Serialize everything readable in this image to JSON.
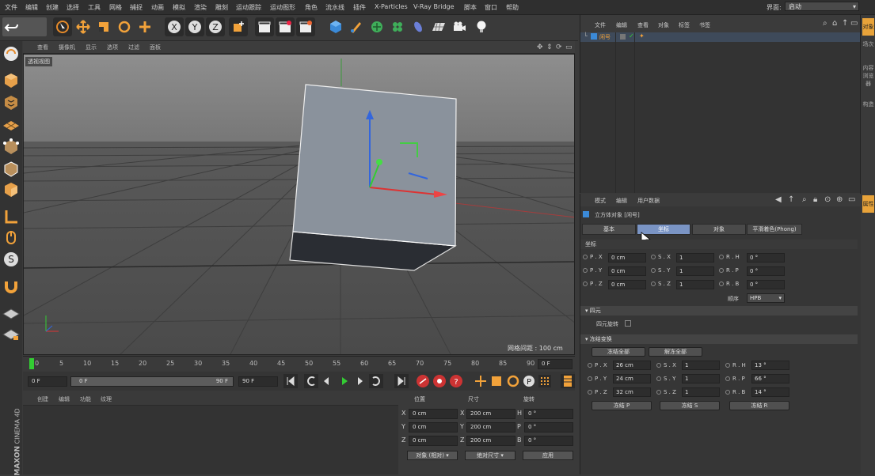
{
  "menu": [
    "文件",
    "编辑",
    "创建",
    "选择",
    "工具",
    "网格",
    "捕捉",
    "动画",
    "模拟",
    "渲染",
    "雕刻",
    "运动跟踪",
    "运动图形",
    "角色",
    "流水线",
    "插件",
    "X-Particles",
    "V-Ray Bridge",
    "脚本",
    "窗口",
    "帮助"
  ],
  "interface": {
    "label": "界面:",
    "value": "启动"
  },
  "viewport": {
    "menu": [
      "查看",
      "摄像机",
      "显示",
      "选项",
      "过滤",
      "面板"
    ],
    "label": "透视视图",
    "grid_spacing": "网格间距 : 100 cm"
  },
  "timeline": {
    "ticks": [
      "0",
      "5",
      "10",
      "15",
      "20",
      "25",
      "30",
      "35",
      "40",
      "45",
      "50",
      "55",
      "60",
      "65",
      "70",
      "75",
      "80",
      "85",
      "90"
    ],
    "current_frame": "0 F"
  },
  "transport": {
    "start": "0 F",
    "slider_start": "0 F",
    "slider_end": "90 F",
    "end": "90 F"
  },
  "material_panel": {
    "menu": [
      "创建",
      "编辑",
      "功能",
      "纹理"
    ]
  },
  "coordinates": {
    "headers": [
      "位置",
      "尺寸",
      "旋转"
    ],
    "rows": [
      {
        "axis": "X",
        "pos": "0 cm",
        "size_axis": "X",
        "size": "200 cm",
        "rot_axis": "H",
        "rot": "0 °"
      },
      {
        "axis": "Y",
        "pos": "0 cm",
        "size_axis": "Y",
        "size": "200 cm",
        "rot_axis": "P",
        "rot": "0 °"
      },
      {
        "axis": "Z",
        "pos": "0 cm",
        "size_axis": "Z",
        "size": "200 cm",
        "rot_axis": "B",
        "rot": "0 °"
      }
    ],
    "mode": "对象 (相对)",
    "size_mode": "绝对尺寸",
    "apply": "应用"
  },
  "object_manager": {
    "menu": [
      "文件",
      "编辑",
      "查看",
      "对象",
      "标签",
      "书签"
    ],
    "object_name": "闲号"
  },
  "right_strip": [
    "对象",
    "场次",
    "内容浏览器",
    "构造",
    "属性"
  ],
  "attributes": {
    "menu": [
      "模式",
      "编辑",
      "用户数据"
    ],
    "title": "立方体对象 [闲号]",
    "tabs": [
      "基本",
      "坐标",
      "对象",
      "平滑着色(Phong)"
    ],
    "active_tab": 1,
    "section_coord": "坐标",
    "coord_rows": [
      {
        "p": "P . X",
        "pv": "0 cm",
        "s": "S . X",
        "sv": "1",
        "r": "R . H",
        "rv": "0 °"
      },
      {
        "p": "P . Y",
        "pv": "0 cm",
        "s": "S . Y",
        "sv": "1",
        "r": "R . P",
        "rv": "0 °"
      },
      {
        "p": "P . Z",
        "pv": "0 cm",
        "s": "S . Z",
        "sv": "1",
        "r": "R . B",
        "rv": "0 °"
      }
    ],
    "order_label": "顺序",
    "order_value": "HPB",
    "section_quat": "四元",
    "quat_label": "四元旋转",
    "section_freeze": "冻结变换",
    "freeze_all": "冻结全部",
    "unfreeze_all": "解冻全部",
    "freeze_rows": [
      {
        "p": "P . X",
        "pv": "26 cm",
        "s": "S . X",
        "sv": "1",
        "r": "R . H",
        "rv": "13 °"
      },
      {
        "p": "P . Y",
        "pv": "24 cm",
        "s": "S . Y",
        "sv": "1",
        "r": "R . P",
        "rv": "66 °"
      },
      {
        "p": "P . Z",
        "pv": "32 cm",
        "s": "S . Z",
        "sv": "1",
        "r": "R . B",
        "rv": "14 °"
      }
    ],
    "freeze_p": "冻结 P",
    "freeze_s": "冻结 S",
    "freeze_r": "冻结 R"
  },
  "brand": {
    "line1": "MAXON",
    "line2": "CINEMA 4D"
  }
}
